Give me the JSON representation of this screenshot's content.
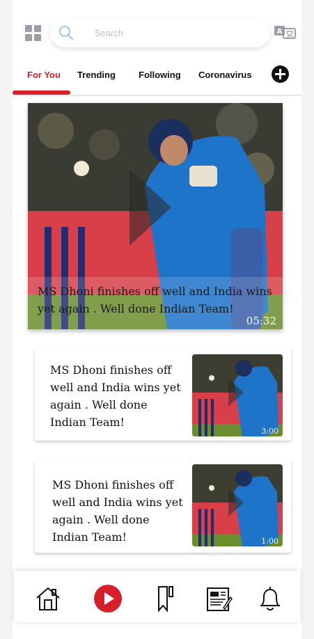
{
  "header": {
    "search_placeholder": "Search"
  },
  "tabs": [
    {
      "label": "For You",
      "active": true
    },
    {
      "label": "Trending",
      "active": false
    },
    {
      "label": "Following",
      "active": false
    },
    {
      "label": "Coronavirus",
      "active": false
    }
  ],
  "featured": {
    "title": "MS Dhoni finishes off well and India wins yet again . Well done Indian Team!",
    "duration": "05:32"
  },
  "videos": [
    {
      "title": "MS Dhoni finishes off well and India wins yet again . Well done Indian Team!",
      "duration": "3:00"
    },
    {
      "title": "MS Dhoni finishes off well and India wins yet again . Well done Indian Team!",
      "duration": "1:00"
    }
  ],
  "bottom_nav": [
    {
      "icon": "home-icon"
    },
    {
      "icon": "play-icon"
    },
    {
      "icon": "bookmark-icon"
    },
    {
      "icon": "news-icon"
    },
    {
      "icon": "bell-icon"
    }
  ],
  "colors": {
    "accent": "#d71f2a",
    "jersey": "#1e74c9"
  }
}
